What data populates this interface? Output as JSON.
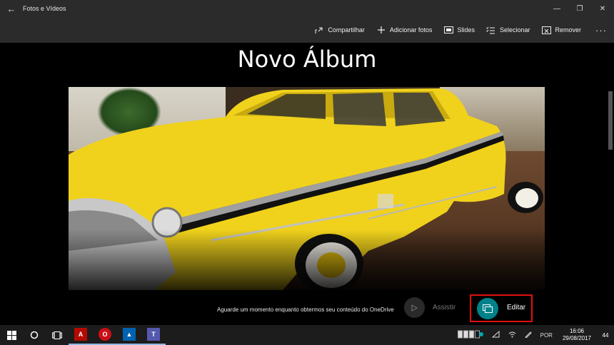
{
  "window": {
    "title": "Fotos e Vídeos",
    "back_icon": "←",
    "minimize_icon": "—",
    "maximize_icon": "❐",
    "close_icon": "✕"
  },
  "toolbar": {
    "share_label": "Compartilhar",
    "add_photos_label": "Adicionar fotos",
    "slides_label": "Slides",
    "select_label": "Selecionar",
    "remove_label": "Remover",
    "more_label": "···"
  },
  "album": {
    "title": "Novo Álbum"
  },
  "footer": {
    "status_text": "Aguarde um momento enquanto obtermos seu conteúdo do OneDrive",
    "watch_label": "Assistir",
    "edit_label": "Editar"
  },
  "taskbar": {
    "language": "POR",
    "time": "16:06",
    "date": "29/08/2017",
    "notifications": "44"
  },
  "colors": {
    "accent": "#00828a",
    "highlight": "#e01010",
    "chrome": "#2b2b2b",
    "taskbar": "#1c1c1c"
  }
}
